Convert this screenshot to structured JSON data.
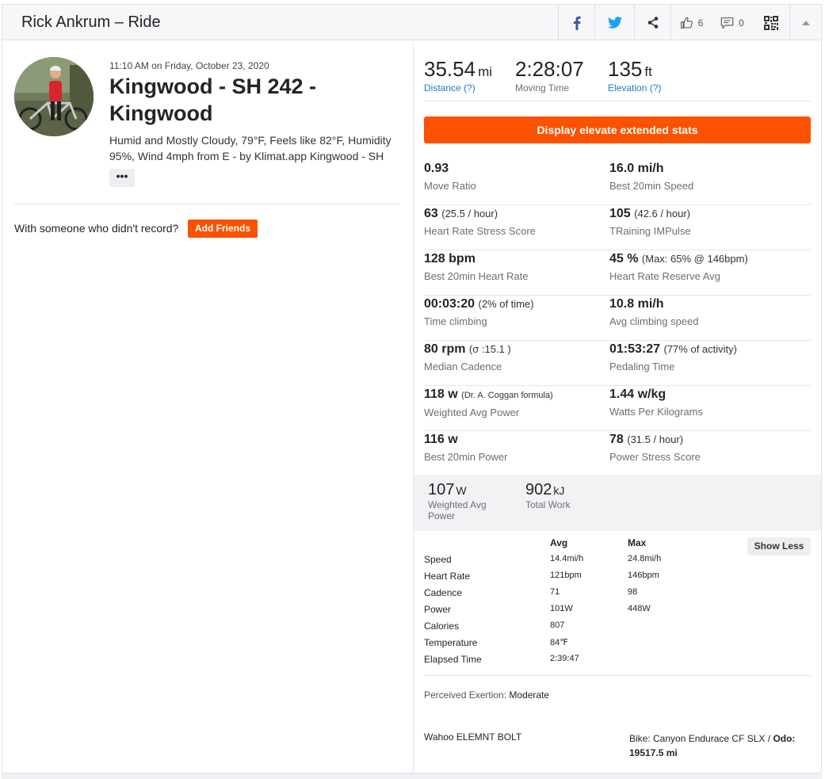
{
  "header": {
    "title": "Rick Ankrum – Ride",
    "kudos_count": "6",
    "comments_count": "0"
  },
  "activity": {
    "datetime": "11:10 AM on Friday, October 23, 2020",
    "title": "Kingwood - SH 242 - Kingwood",
    "description": "Humid and Mostly Cloudy, 79°F, Feels like 82°F, Humidity 95%, Wind 4mph from E - by Klimat.app Kingwood - SH",
    "more_label": "•••",
    "with_someone": "With someone who didn't record?",
    "add_friends": "Add Friends"
  },
  "summary": [
    {
      "value": "35.54",
      "unit": "mi",
      "label": "Distance (?)"
    },
    {
      "value": "2:28:07",
      "unit": "",
      "label": "Moving Time"
    },
    {
      "value": "135",
      "unit": "ft",
      "label": "Elevation (?)"
    }
  ],
  "elevate_button": "Display elevate extended stats",
  "extended_stats": [
    [
      {
        "value": "0.93",
        "extra": "",
        "label": "Move Ratio"
      },
      {
        "value": "16.0 mi/h",
        "extra": "",
        "label": "Best 20min Speed"
      }
    ],
    [
      {
        "value": "63",
        "extra": "(25.5 / hour)",
        "label": "Heart Rate Stress Score"
      },
      {
        "value": "105",
        "extra": "(42.6 / hour)",
        "label": "TRaining IMPulse"
      }
    ],
    [
      {
        "value": "128 bpm",
        "extra": "",
        "label": "Best 20min Heart Rate"
      },
      {
        "value": "45 %",
        "extra": "(Max: 65% @ 146bpm)",
        "label": "Heart Rate Reserve Avg"
      }
    ],
    [
      {
        "value": "00:03:20",
        "extra": "(2% of time)",
        "label": "Time climbing"
      },
      {
        "value": "10.8 mi/h",
        "extra": "",
        "label": "Avg climbing speed"
      }
    ],
    [
      {
        "value": "80 rpm",
        "extra": "(σ :15.1 )",
        "label": "Median Cadence"
      },
      {
        "value": "01:53:27",
        "extra": "(77% of activity)",
        "label": "Pedaling Time"
      }
    ],
    [
      {
        "value": "118 w",
        "extra": "(Dr. A. Coggan formula)",
        "label": "Weighted Avg Power"
      },
      {
        "value": "1.44 w/kg",
        "extra": "",
        "label": "Watts Per Kilograms"
      }
    ],
    [
      {
        "value": "116 w",
        "extra": "",
        "label": "Best 20min Power"
      },
      {
        "value": "78",
        "extra": "(31.5 / hour)",
        "label": "Power Stress Score"
      }
    ]
  ],
  "power_band": [
    {
      "value": "107",
      "unit": "W",
      "label": "Weighted Avg Power"
    },
    {
      "value": "902",
      "unit": "kJ",
      "label": "Total Work"
    }
  ],
  "more_stats": {
    "headers": [
      "",
      "Avg",
      "Max"
    ],
    "rows": [
      [
        "Speed",
        "14.4mi/h",
        "24.8mi/h"
      ],
      [
        "Heart Rate",
        "121bpm",
        "146bpm"
      ],
      [
        "Cadence",
        "71",
        "98"
      ],
      [
        "Power",
        "101W",
        "448W"
      ],
      [
        "Calories",
        "807",
        ""
      ],
      [
        "Temperature",
        "84℉",
        ""
      ],
      [
        "Elapsed Time",
        "2:39:47",
        ""
      ]
    ],
    "show_less": "Show Less"
  },
  "exertion": {
    "label": "Perceived Exertion:",
    "value": "Moderate"
  },
  "device": "Wahoo ELEMNT BOLT",
  "bike": {
    "text": "Bike: Canyon Endurace CF SLX / ",
    "odo_label": "Odo:",
    "odo_value": "19517.5 mi"
  },
  "colors": {
    "brand": "#fc5200",
    "link": "#1e7ac9",
    "facebook": "#3b5998",
    "twitter": "#1da1f2"
  },
  "icons": [
    "facebook-icon",
    "twitter-icon",
    "share-icon",
    "thumbs-up-icon",
    "comment-icon",
    "qr-code-icon",
    "collapse-arrow-icon"
  ]
}
